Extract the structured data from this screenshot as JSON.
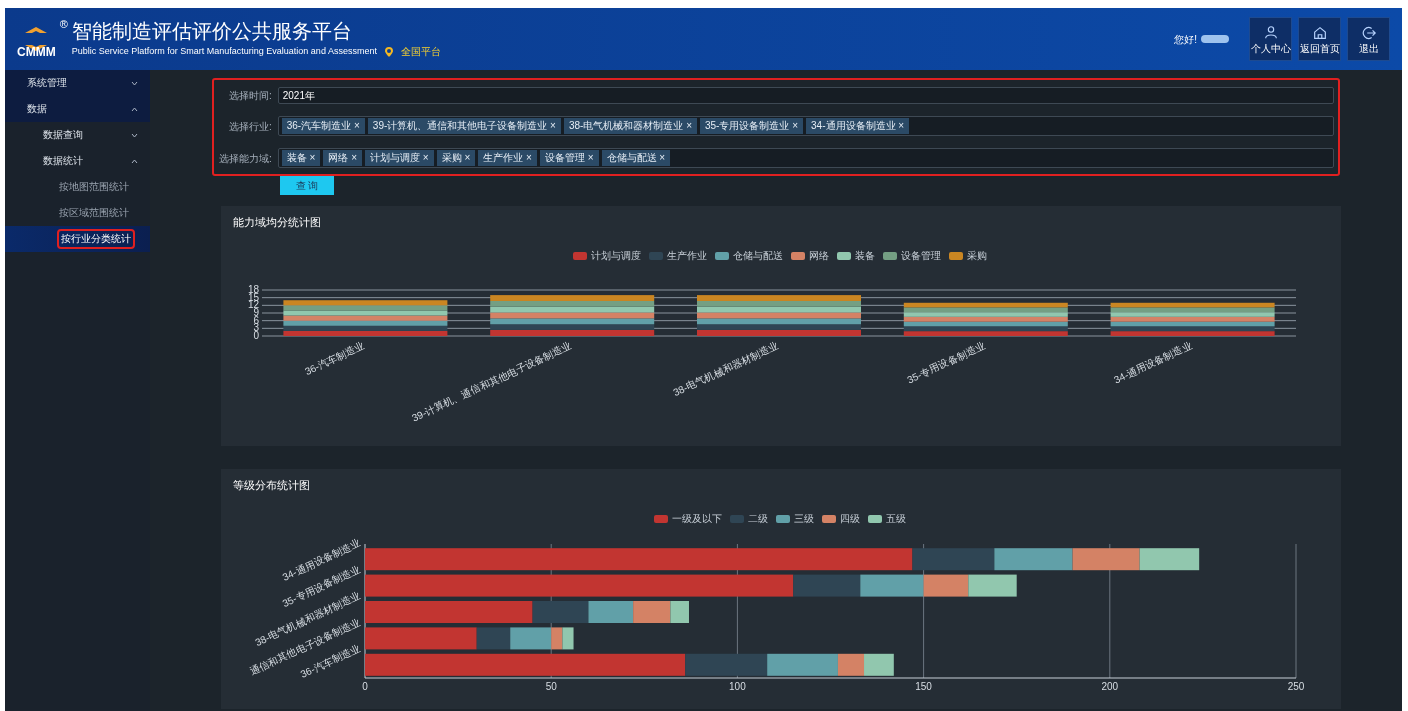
{
  "header": {
    "logo_text": "CMMM",
    "registered_mark": "®",
    "title": "智能制造评估评价公共服务平台",
    "subtitle": "Public Service Platform for Smart Manufacturing Evaluation and Assessment",
    "region": "全国平台",
    "greeting": "您好!",
    "actions": [
      {
        "label": "个人中心",
        "kind": "person"
      },
      {
        "label": "返回首页",
        "kind": "home"
      },
      {
        "label": "退出",
        "kind": "exit"
      }
    ]
  },
  "sidebar": {
    "items": [
      {
        "label": "系统管理",
        "expanded": false
      },
      {
        "label": "数据",
        "expanded": true,
        "children": [
          {
            "label": "数据查询",
            "expanded": false
          },
          {
            "label": "数据统计",
            "expanded": true,
            "children": [
              {
                "label": "按地图范围统计",
                "selected": false,
                "highlighted": false
              },
              {
                "label": "按区域范围统计",
                "selected": false,
                "highlighted": false
              },
              {
                "label": "按行业分类统计",
                "selected": true,
                "highlighted": true
              }
            ]
          }
        ]
      }
    ]
  },
  "filters": {
    "highlighted": true,
    "fields": [
      {
        "label": "选择时间:",
        "kind": "text",
        "value": "2021年"
      },
      {
        "label": "选择行业:",
        "kind": "tags",
        "tags": [
          "36-汽车制造业 ×",
          "39-计算机、通信和其他电子设备制造业 ×",
          "38-电气机械和器材制造业 ×",
          "35-专用设备制造业 ×",
          "34-通用设备制造业 ×"
        ]
      },
      {
        "label": "选择能力域:",
        "kind": "tags",
        "tags": [
          "装备 ×",
          "网络 ×",
          "计划与调度 ×",
          "采购 ×",
          "生产作业 ×",
          "设备管理 ×",
          "仓储与配送 ×"
        ]
      }
    ],
    "query_button": "查 询"
  },
  "charts": [
    {
      "chart_data": {
        "type": "bar",
        "title": "能力域均分统计图",
        "orientation": "vertical",
        "stacked": true,
        "legend": true,
        "grid": true,
        "categories": [
          "36-汽车制造业",
          "39-计算机、通信和其他电子设备制造业",
          "38-电气机械和器材制造业",
          "35-专用设备制造业",
          "34-通用设备制造业"
        ],
        "ylim": [
          0,
          18
        ],
        "yticks": [
          0,
          3,
          6,
          9,
          12,
          15,
          18
        ],
        "series": [
          {
            "name": "计划与调度",
            "color": "#c23531",
            "values": [
              2,
              2.4,
              2.4,
              1.9,
              1.9
            ]
          },
          {
            "name": "生产作业",
            "color": "#2f4554",
            "values": [
              2,
              2.2,
              2.2,
              1.9,
              1.9
            ]
          },
          {
            "name": "仓储与配送",
            "color": "#61a0a8",
            "values": [
              2,
              2.3,
              2.3,
              1.8,
              1.8
            ]
          },
          {
            "name": "网络",
            "color": "#d48265",
            "values": [
              2,
              2.3,
              2.3,
              1.9,
              1.9
            ]
          },
          {
            "name": "装备",
            "color": "#91c7ae",
            "values": [
              2,
              2.3,
              2.3,
              1.8,
              1.8
            ]
          },
          {
            "name": "设备管理",
            "color": "#749f83",
            "values": [
              2,
              2.2,
              2.2,
              1.9,
              1.9
            ]
          },
          {
            "name": "采购",
            "color": "#ca8622",
            "values": [
              2,
              2.3,
              2.3,
              1.8,
              1.8
            ]
          }
        ]
      }
    },
    {
      "chart_data": {
        "type": "bar",
        "title": "等级分布统计图",
        "orientation": "horizontal",
        "stacked": true,
        "legend": true,
        "grid": true,
        "categories": [
          "34-通用设备制造业",
          "35-专用设备制造业",
          "38-电气机械和器材制造业",
          "通信和其他电子设备制造业",
          "36-汽车制造业"
        ],
        "xlim": [
          0,
          250
        ],
        "xticks": [
          0,
          50,
          100,
          150,
          200,
          250
        ],
        "series": [
          {
            "name": "一级及以下",
            "color": "#c23531",
            "values": [
              147,
              115,
              45,
              30,
              86
            ]
          },
          {
            "name": "二级",
            "color": "#2f4554",
            "values": [
              22,
              18,
              15,
              9,
              22
            ]
          },
          {
            "name": "三级",
            "color": "#61a0a8",
            "values": [
              21,
              17,
              12,
              11,
              19
            ]
          },
          {
            "name": "四级",
            "color": "#d48265",
            "values": [
              18,
              12,
              10,
              3,
              7
            ]
          },
          {
            "name": "五级",
            "color": "#91c7ae",
            "values": [
              16,
              13,
              5,
              3,
              8
            ]
          }
        ]
      }
    }
  ]
}
